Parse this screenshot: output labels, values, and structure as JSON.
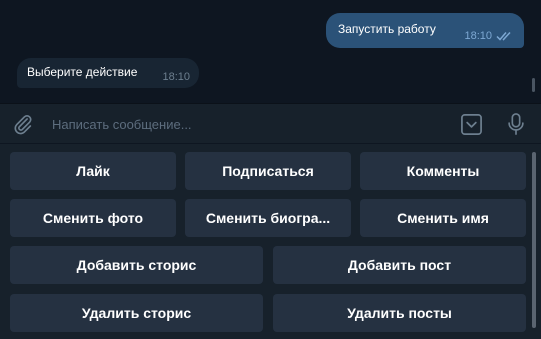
{
  "chat": {
    "outgoing": {
      "text": "Запустить работу",
      "time": "18:10"
    },
    "incoming": {
      "text": "Выберите действие",
      "time": "18:10"
    }
  },
  "input": {
    "placeholder": "Написать сообщение..."
  },
  "icons": {
    "attach": "paperclip-icon",
    "keyboard": "bot-keyboard-icon",
    "mic": "microphone-icon",
    "read_status": "double-check-icon"
  },
  "keyboard": {
    "row1": [
      "Лайк",
      "Подписаться",
      "Комменты"
    ],
    "row2": [
      "Сменить фото",
      "Сменить биогра...",
      "Сменить имя"
    ],
    "row3": [
      "Добавить сторис",
      "Добавить пост"
    ],
    "row4": [
      "Удалить сторис",
      "Удалить посты"
    ]
  },
  "colors": {
    "background": "#0e1621",
    "panel": "#17212b",
    "outgoing_bubble": "#2b5278",
    "incoming_bubble": "#182533",
    "button": "#253141",
    "placeholder": "#5d6d7e"
  }
}
